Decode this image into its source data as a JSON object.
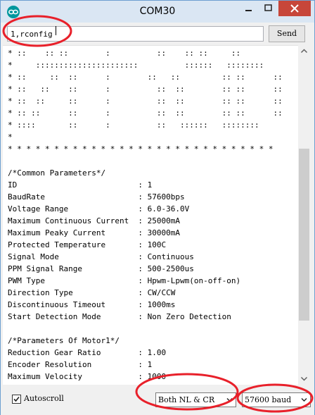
{
  "window": {
    "title": "COM30",
    "icon": "arduino-icon"
  },
  "toolbar": {
    "input_value": "1,rconfig",
    "send_label": "Send"
  },
  "output": {
    "lines": [
      "* ::    :: ::        :          ::    :: ::     ::",
      "*     ::::::::::::::::::::::          ::::::   ::::::::",
      "* ::     ::  ::      :        ::   ::         :: ::      ::",
      "* ::   ::    ::      :          ::  ::        :: ::      ::",
      "* ::  ::     ::      :          ::  ::        :: ::      ::",
      "* :: ::      ::      :          ::  ::        :: ::      ::",
      "* ::::       ::      :          ::   ::::::   ::::::::",
      "*",
      "* * * * * * * * * * * * * * * * * * * * * * * * * * * * *",
      "",
      "/*Common Parameters*/",
      "ID                          : 1",
      "BaudRate                    : 57600bps",
      "Voltage Range               : 6.0-36.0V",
      "Maximum Continuous Current  : 25000mA",
      "Maximum Peaky Current       : 30000mA",
      "Protected Temperature       : 100C",
      "Signal Mode                 : Continuous",
      "PPM Signal Range            : 500-2500us",
      "PWM Type                    : Hpwm-Lpwm(on-off-on)",
      "Direction Type              : CW/CCW",
      "Discontinuous Timeout       : 1000ms",
      "Start Detection Mode        : Non Zero Detection",
      "",
      "/*Parameters Of Motor1*/",
      "Reduction Gear Ratio        : 1.00",
      "Encoder Resolution          : 1",
      "Maximum Velocity            : 1000"
    ]
  },
  "status_bar": {
    "autoscroll_label": "Autoscroll",
    "autoscroll_checked": true,
    "line_ending_value": "Both NL & CR",
    "baud_value": "57600 baud"
  },
  "colors": {
    "accent": "#00979d",
    "annotation": "#e8202a",
    "close_button": "#c7463a"
  }
}
